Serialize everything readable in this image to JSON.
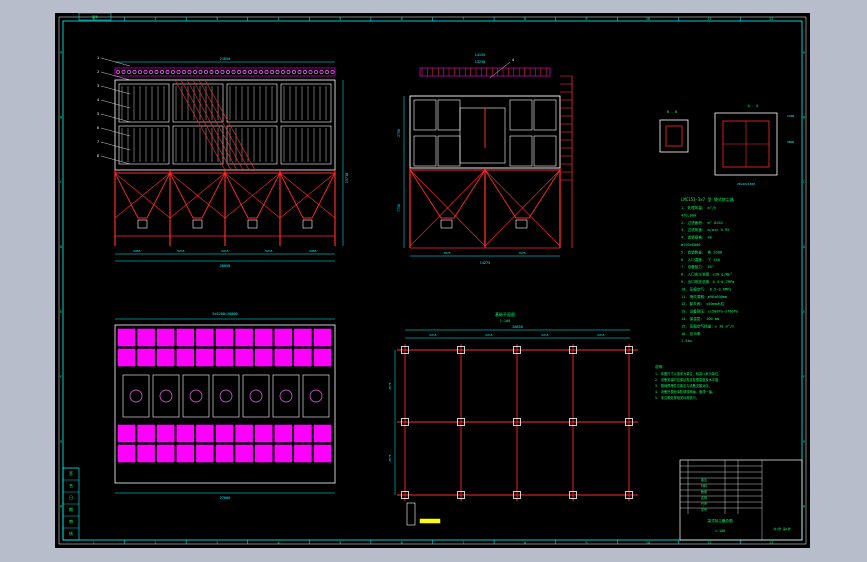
{
  "drawing": {
    "background": "#000000",
    "viewport_bg": "#b7bdca",
    "colors": {
      "border": "#00ffff",
      "structure": "#ff2a2a",
      "frame": "#ffffff",
      "dimension": "#00ffff",
      "text": "#00ff66",
      "filter": "#ff00ff",
      "outline": "#ff66ff",
      "accent": "#ffff00"
    },
    "grid_top_numbers": [
      "1",
      "2",
      "3",
      "4",
      "5",
      "6",
      "7",
      "8",
      "9",
      "10",
      "11",
      "12"
    ],
    "grid_side_letters": [
      "A",
      "B",
      "C",
      "D",
      "E",
      "F",
      "G",
      "H"
    ],
    "front_view": {
      "top_dim": "21850",
      "bottom_dims": [
        "5285",
        "5215",
        "5215",
        "5215",
        "5285"
      ],
      "total_width": "26858",
      "height_dim": "15710",
      "leaders": [
        "1",
        "2",
        "3",
        "4",
        "5",
        "6",
        "7",
        "8"
      ]
    },
    "side_view": {
      "top_dims": [
        "14155",
        "13250"
      ],
      "bottom_dims": [
        "7075",
        "7075"
      ],
      "total_width": "14275",
      "height_dim_a": "2750",
      "height_dim_b": "7750",
      "leader": "4"
    },
    "plan_view": {
      "top_dim": "5x5200=26000",
      "bottom_dim": "27000",
      "row_count": "5",
      "hole_count": "7"
    },
    "foundation": {
      "title": "基础平面图",
      "subtitle": "1:100",
      "dims": [
        "5215",
        "5215",
        "5215",
        "5215",
        "5215"
      ],
      "total": "26858",
      "side_dims": [
        "3575",
        "3575"
      ]
    },
    "detail_views": {
      "left_label": "B - B",
      "right_label": "A - A",
      "dims_right": [
        "1200",
        "4800"
      ],
      "bottom_text": "20x40x1500"
    },
    "spec_title": "LMC153-3x7 型 袋式除尘器",
    "spec_lines": [
      "1. 处理风量：   m³/h",
      "   470,000",
      "2. 过滤面积：  m²      8264",
      "3. 过滤风速：   m/min   0.95",
      "4. 滤袋规格：          mm",
      "   ø130x6000",
      "5. 滤袋数量：  条         2688",
      "6. 入口温度：  ℃         150",
      "7. 设备阻力：           65°",
      "8. 入口含尘浓度：≤30 g/Nm³",
      "9. 出口排放浓度：0.5~0.7MPa",
      "10. 压缩空气：  0.5~0.6MPa",
      "11. 喷吹周期：ø90x600mm",
      "12. 卸灰阀：   ≤50mm水柱",
      "13. 设备耐压：±1500Pa~3700Pa",
      "14. 保温层：   100 mm",
      "15. 压缩空气耗量：≤ 30 m³/h",
      "16. 总功率",
      "1.5kw"
    ],
    "notes_title": "说明：",
    "notes_lines": [
      "1. 本图尺寸以毫米为单位，标高以米为单位。",
      "2. 设备安装时应保证各支柱垂直度及水平度。",
      "3. 基础预埋件位置应与设备支腿对应。",
      "4. 设备外表面涂防锈漆两遍，面漆一遍。",
      "5. 未注明处按相关标准执行。"
    ],
    "title_block": {
      "rows": [
        "序号",
        "代号",
        "名称",
        "数量",
        "材料",
        "备注"
      ],
      "project": "袋式除尘器总图",
      "scale": "1:100",
      "sheet": "共1张 第1张"
    },
    "revision_left": [
      "签",
      "名",
      "日",
      "期",
      "审",
      "核"
    ]
  }
}
